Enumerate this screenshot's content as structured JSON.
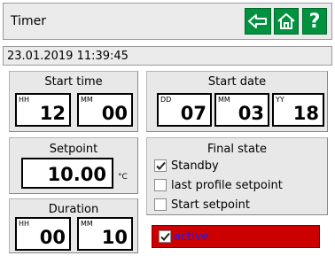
{
  "header": {
    "title": "Timer",
    "back_icon": "back-arrow-icon",
    "home_icon": "home-icon",
    "help_label": "?",
    "accent_color": "#00923f"
  },
  "datetime": "23.01.2019 11:39:45",
  "start_time": {
    "title": "Start time",
    "hours_unit": "HH",
    "hours": "12",
    "minutes_unit": "MM",
    "minutes": "00"
  },
  "start_date": {
    "title": "Start date",
    "day_unit": "DD",
    "day": "07",
    "month_unit": "MM",
    "month": "03",
    "year_unit": "YY",
    "year": "18"
  },
  "setpoint": {
    "title": "Setpoint",
    "value": "10.00",
    "unit": "°C"
  },
  "duration": {
    "title": "Duration",
    "hours_unit": "HH",
    "hours": "00",
    "minutes_unit": "MM",
    "minutes": "10"
  },
  "final_state": {
    "title": "Final state",
    "options": [
      {
        "label": "Standby",
        "checked": true
      },
      {
        "label": "last profile setpoint",
        "checked": false
      },
      {
        "label": "Start setpoint",
        "checked": false
      }
    ]
  },
  "active": {
    "label": "active",
    "checked": true,
    "color": "#cc0000",
    "label_color": "#1a1aff"
  }
}
